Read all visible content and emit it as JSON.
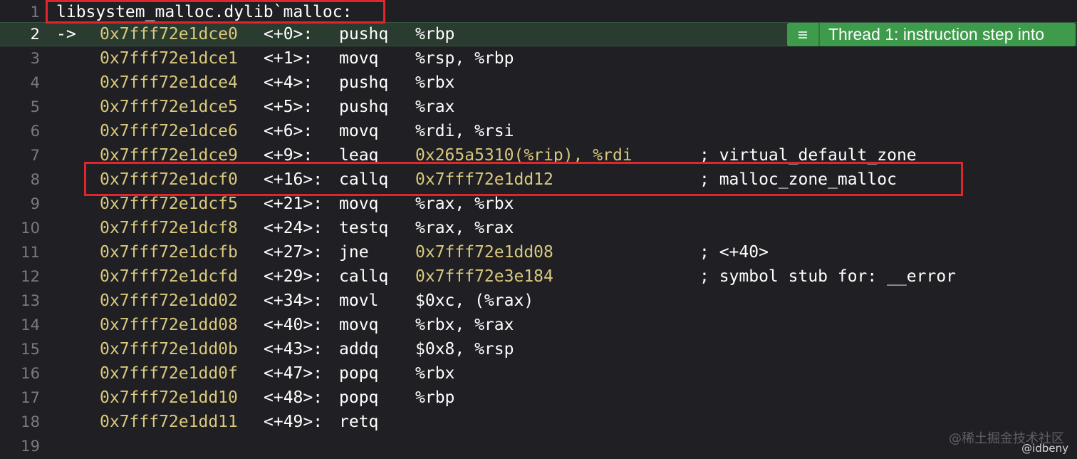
{
  "header": {
    "line_no": "1",
    "symbol": "libsystem_malloc.dylib`malloc:"
  },
  "pc_arrow": "->",
  "thread_badge": {
    "label": "Thread 1: instruction step into",
    "icon": "list-icon"
  },
  "lines": [
    {
      "n": "2",
      "addr": "0x7fff72e1dce0",
      "off": "<+0>:",
      "mnem": "pushq",
      "ops": "%rbp",
      "comment": ""
    },
    {
      "n": "3",
      "addr": "0x7fff72e1dce1",
      "off": "<+1>:",
      "mnem": "movq",
      "ops": "%rsp, %rbp",
      "comment": ""
    },
    {
      "n": "4",
      "addr": "0x7fff72e1dce4",
      "off": "<+4>:",
      "mnem": "pushq",
      "ops": "%rbx",
      "comment": ""
    },
    {
      "n": "5",
      "addr": "0x7fff72e1dce5",
      "off": "<+5>:",
      "mnem": "pushq",
      "ops": "%rax",
      "comment": ""
    },
    {
      "n": "6",
      "addr": "0x7fff72e1dce6",
      "off": "<+6>:",
      "mnem": "movq",
      "ops": "%rdi, %rsi",
      "comment": ""
    },
    {
      "n": "7",
      "addr": "0x7fff72e1dce9",
      "off": "<+9>:",
      "mnem": "leaq",
      "ops": "0x265a5310(%rip), %rdi",
      "comment": "; virtual_default_zone"
    },
    {
      "n": "8",
      "addr": "0x7fff72e1dcf0",
      "off": "<+16>:",
      "mnem": "callq",
      "ops": "0x7fff72e1dd12",
      "comment": "; malloc_zone_malloc"
    },
    {
      "n": "9",
      "addr": "0x7fff72e1dcf5",
      "off": "<+21>:",
      "mnem": "movq",
      "ops": "%rax, %rbx",
      "comment": ""
    },
    {
      "n": "10",
      "addr": "0x7fff72e1dcf8",
      "off": "<+24>:",
      "mnem": "testq",
      "ops": "%rax, %rax",
      "comment": ""
    },
    {
      "n": "11",
      "addr": "0x7fff72e1dcfb",
      "off": "<+27>:",
      "mnem": "jne",
      "ops": "0x7fff72e1dd08",
      "comment": "; <+40>"
    },
    {
      "n": "12",
      "addr": "0x7fff72e1dcfd",
      "off": "<+29>:",
      "mnem": "callq",
      "ops": "0x7fff72e3e184",
      "comment": "; symbol stub for: __error"
    },
    {
      "n": "13",
      "addr": "0x7fff72e1dd02",
      "off": "<+34>:",
      "mnem": "movl",
      "ops": "$0xc, (%rax)",
      "comment": ""
    },
    {
      "n": "14",
      "addr": "0x7fff72e1dd08",
      "off": "<+40>:",
      "mnem": "movq",
      "ops": "%rbx, %rax",
      "comment": ""
    },
    {
      "n": "15",
      "addr": "0x7fff72e1dd0b",
      "off": "<+43>:",
      "mnem": "addq",
      "ops": "$0x8, %rsp",
      "comment": ""
    },
    {
      "n": "16",
      "addr": "0x7fff72e1dd0f",
      "off": "<+47>:",
      "mnem": "popq",
      "ops": "%rbx",
      "comment": ""
    },
    {
      "n": "17",
      "addr": "0x7fff72e1dd10",
      "off": "<+48>:",
      "mnem": "popq",
      "ops": "%rbp",
      "comment": ""
    },
    {
      "n": "18",
      "addr": "0x7fff72e1dd11",
      "off": "<+49>:",
      "mnem": "retq",
      "ops": "",
      "comment": ""
    },
    {
      "n": "19",
      "addr": "",
      "off": "",
      "mnem": "",
      "ops": "",
      "comment": ""
    }
  ],
  "watermark": {
    "site": "@稀土掘金技术社区",
    "author": "@idbeny"
  },
  "colors": {
    "background": "#1f1f24",
    "address": "#d9c97c",
    "current_line": "#2a3b30",
    "badge": "#3f9b4c",
    "highlight_box": "#e0262c"
  }
}
